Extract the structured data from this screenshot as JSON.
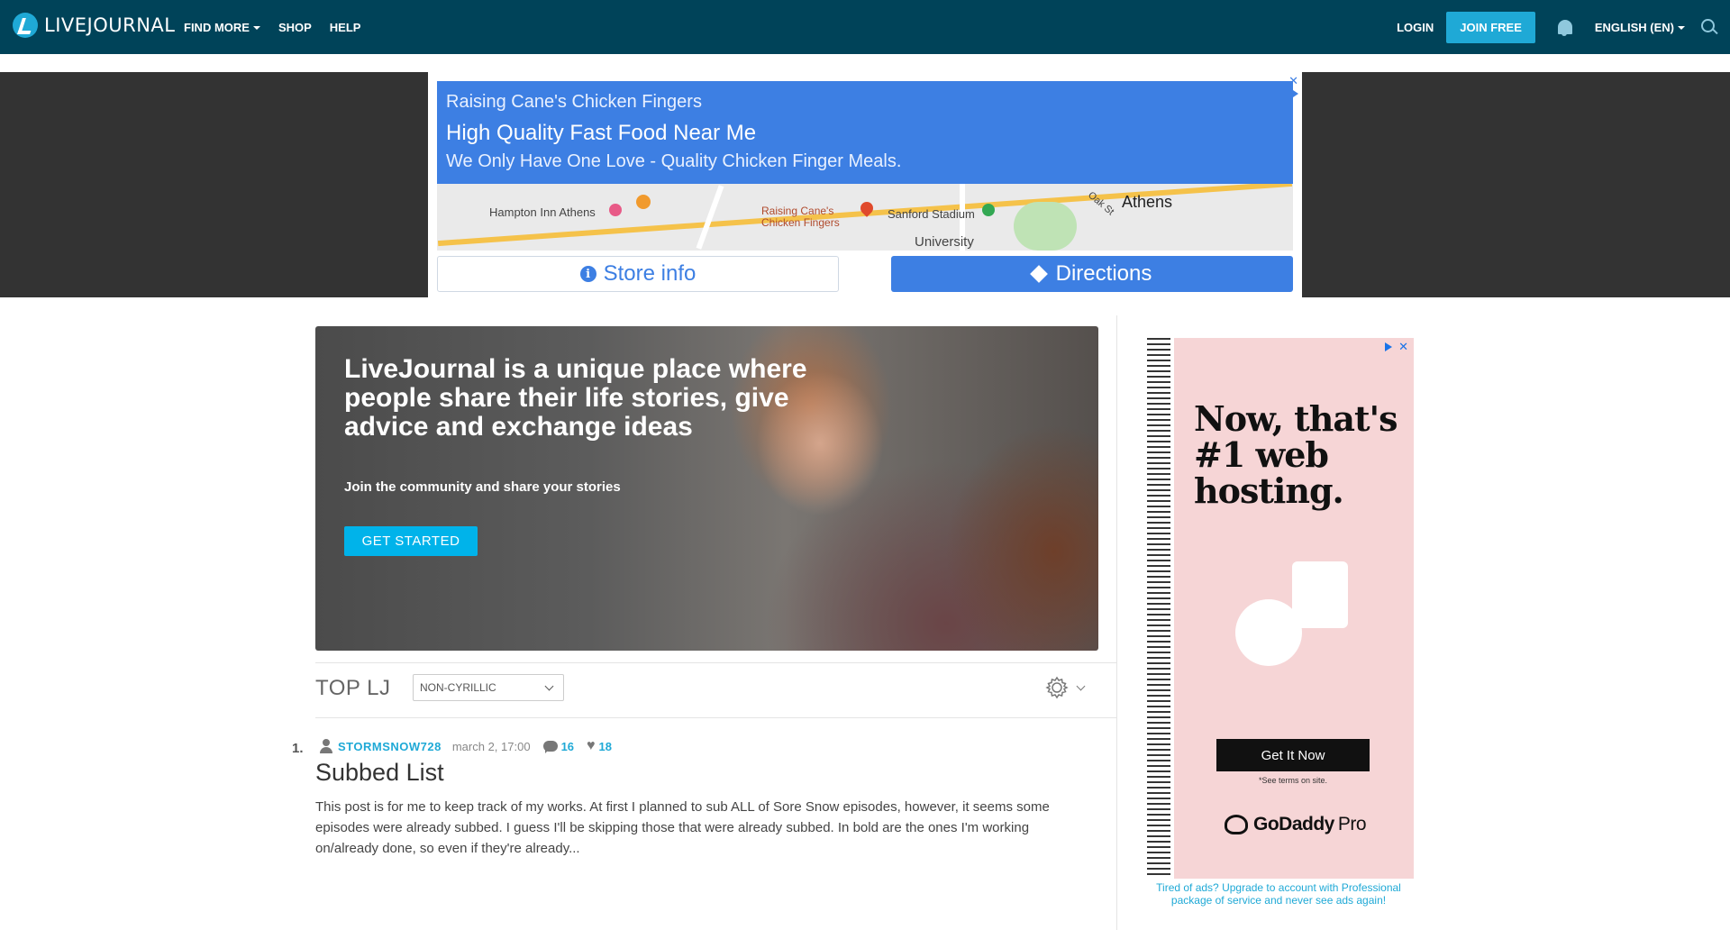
{
  "header": {
    "logo_text": "LIVEJOURNAL",
    "nav": [
      "FIND MORE",
      "SHOP",
      "HELP"
    ],
    "login": "LOGIN",
    "join": "JOIN FREE",
    "language": "ENGLISH (EN)",
    "brand_color": "#004359",
    "accent_color": "#1fa9d6"
  },
  "top_ad": {
    "advertiser": "Raising Cane's Chicken Fingers",
    "headline": "High Quality Fast Food Near Me",
    "tagline": "We Only Have One Love - Quality Chicken Finger Meals.",
    "map_labels": [
      "Hampton Inn Athens",
      "Raising Cane's Chicken Fingers",
      "Sanford Stadium",
      "Athens",
      "University",
      "Oak St"
    ],
    "store_info": "Store info",
    "directions": "Directions",
    "ad_color": "#3d7fe3"
  },
  "hero": {
    "title": "LiveJournal is a unique place where people share their life stories, give advice and exchange ideas",
    "subtitle": "Join the community and share your stories",
    "cta": "GET STARTED"
  },
  "toplj": {
    "title": "TOP LJ",
    "filter": "NON-CYRILLIC"
  },
  "post": {
    "rank": "1.",
    "username": "STORMSNOW728",
    "date": "march 2, 17:00",
    "comments": "16",
    "likes": "18",
    "title": "Subbed List",
    "excerpt": "This post is for me to keep track of my works. At first I planned to sub ALL of Sore Snow episodes, however, it seems some episodes were already subbed. I guess I'll be skipping those that were already subbed. In bold are the ones I'm working on/already done, so even if they're already..."
  },
  "side_ad": {
    "headline": "Now, that's #1 web hosting.",
    "cta": "Get It Now",
    "terms": "*See terms on site.",
    "brand": "GoDaddy",
    "brand_suffix": "Pro",
    "note": "Tired of ads? Upgrade to account with Professional package of service and never see ads again!"
  }
}
